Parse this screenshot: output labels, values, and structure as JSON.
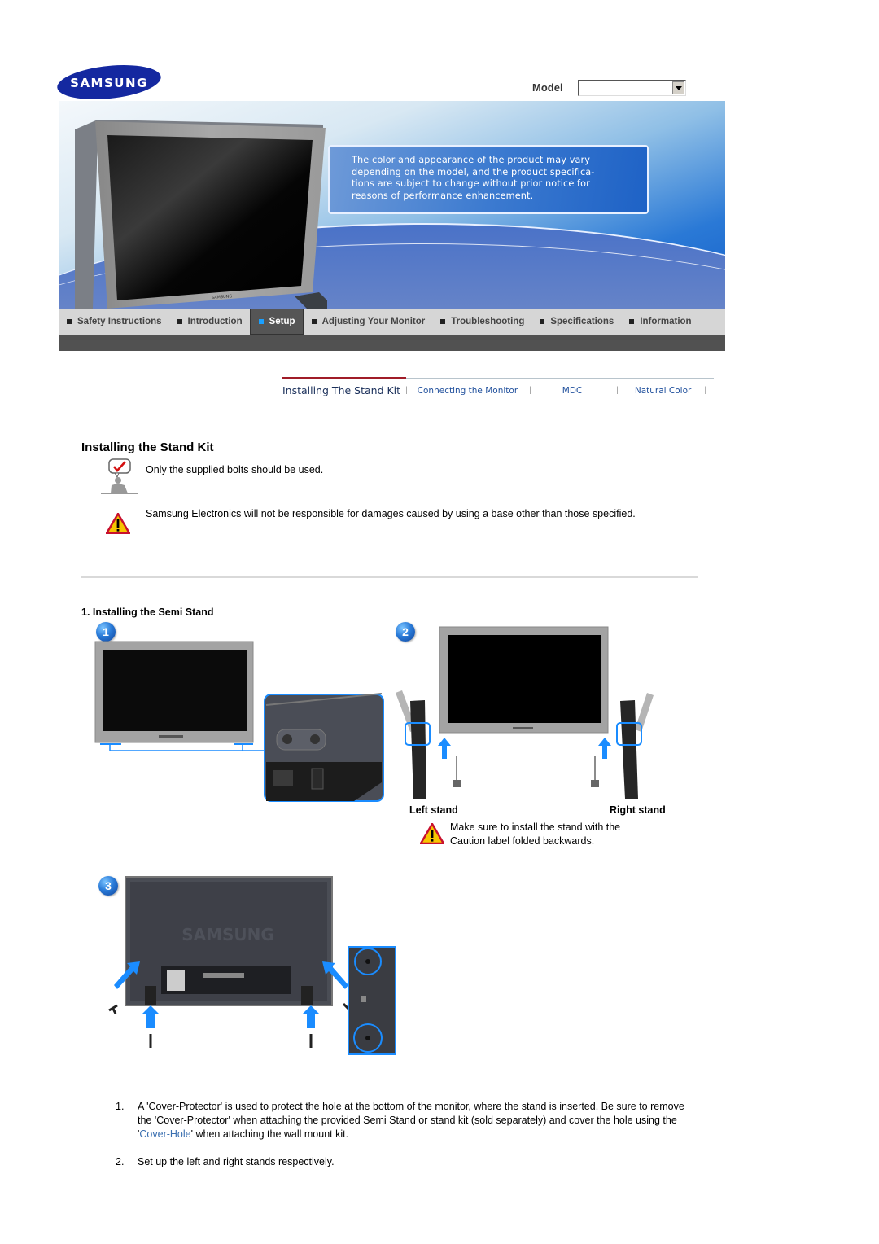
{
  "header": {
    "brand": "SAMSUNG",
    "model_label": "Model",
    "model_select_value": ""
  },
  "banner": {
    "notice": "The color and appearance of the product may vary depending on the model, and the product specifica- tions are subject to change without prior notice for reasons of performance enhancement.",
    "notice_lines": [
      "The color and appearance of the product may vary",
      "depending on the model, and the product specifica-",
      "tions are subject to change without prior notice for",
      "reasons of performance enhancement."
    ],
    "monitor_brand": "SAMSUNG"
  },
  "main_nav": {
    "items": [
      {
        "label": "Safety Instructions",
        "active": false
      },
      {
        "label": "Introduction",
        "active": false
      },
      {
        "label": "Setup",
        "active": true
      },
      {
        "label": "Adjusting Your Monitor",
        "active": false
      },
      {
        "label": "Troubleshooting",
        "active": false
      },
      {
        "label": "Specifications",
        "active": false
      },
      {
        "label": "Information",
        "active": false
      }
    ]
  },
  "sub_nav": {
    "items": [
      {
        "label": "Installing The Stand Kit",
        "active": true
      },
      {
        "label": "Connecting the Monitor",
        "active": false
      },
      {
        "label": "MDC",
        "active": false
      },
      {
        "label": "Natural Color",
        "active": false
      }
    ],
    "active_color": "#a01c28",
    "link_color": "#1f4f9c"
  },
  "content": {
    "title": "Installing the Stand Kit",
    "note": "Only the supplied bolts should be used.",
    "warning": "Samsung Electronics will not be responsible for damages caused by using a base other than those specified.",
    "section_title": "1. Installing the Semi Stand",
    "steps": [
      "1",
      "2",
      "3"
    ],
    "left_stand_label": "Left stand",
    "right_stand_label": "Right stand",
    "stand_warning_line1": "Make sure to install the stand with the",
    "stand_warning_line2": "Caution label folded backwards.",
    "rear_brand": "SAMSUNG",
    "instructions": [
      {
        "num": "1.",
        "pre": "A 'Cover-Protector' is used to protect the hole at the bottom of the monitor, where the stand is inserted. Be sure to remove the 'Cover-Protector' when attaching the provided Semi Stand or stand kit (sold separately) and cover the hole using the '",
        "link": "Cover-Hole",
        "post": "' when attaching the wall mount kit."
      },
      {
        "num": "2.",
        "pre": "Set up the left and right stands respectively.",
        "link": "",
        "post": ""
      }
    ]
  },
  "colors": {
    "brand_blue": "#1428a0",
    "nav_bg": "#d6d6d6",
    "nav_active_bg": "#555555",
    "nav_active_bullet": "#1aa0ff",
    "nav_dark_bar": "#515151",
    "link": "#3a6fb0",
    "callout_blue": "#1a8cff"
  }
}
